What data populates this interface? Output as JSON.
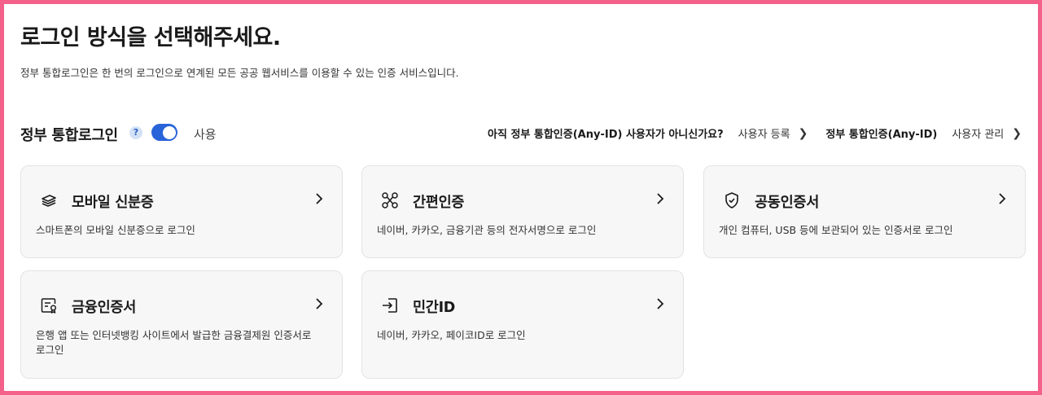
{
  "header": {
    "title": "로그인 방식을 선택해주세요.",
    "description": "정부 통합로그인은 한 번의 로그인으로 연계된 모든 공공 웹서비스를 이용할 수 있는 인증 서비스입니다."
  },
  "section": {
    "title": "정부 통합로그인",
    "help_icon": "?",
    "toggle_label": "사용",
    "toggle_on": true,
    "question": "아직 정부 통합인증(Any-ID) 사용자가 아니신가요?",
    "register_link": "사용자 등록",
    "anyid_label": "정부 통합인증(Any-ID)",
    "manage_link": "사용자 관리"
  },
  "cards": [
    {
      "icon": "mobile-id-icon",
      "title": "모바일 신분증",
      "description": "스마트폰의 모바일 신분증으로 로그인"
    },
    {
      "icon": "simple-auth-icon",
      "title": "간편인증",
      "description": "네이버, 카카오, 금융기관 등의 전자서명으로 로그인"
    },
    {
      "icon": "shield-icon",
      "title": "공동인증서",
      "description": "개인 컴퓨터, USB 등에 보관되어 있는 인증서로 로그인"
    },
    {
      "icon": "certificate-icon",
      "title": "금융인증서",
      "description": "은행 앱 또는 인터넷뱅킹 사이트에서 발급한 금융결제원 인증서로 로그인"
    },
    {
      "icon": "login-arrow-icon",
      "title": "민간ID",
      "description": "네이버, 카카오, 페이코ID로 로그인"
    }
  ],
  "colors": {
    "frame": "#f3618a",
    "accent": "#2863d9",
    "card_bg": "#f7f7f8"
  }
}
